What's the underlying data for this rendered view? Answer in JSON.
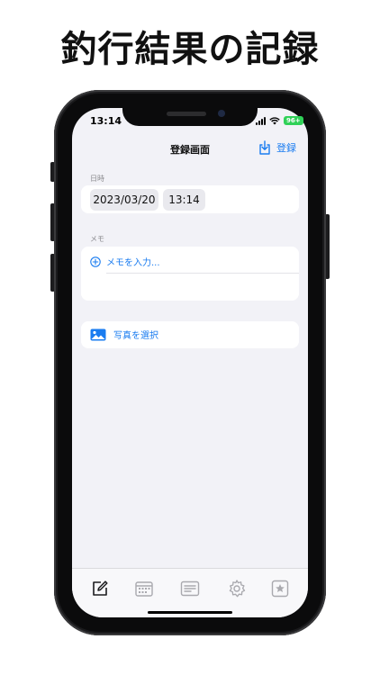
{
  "headline": "釣行結果の記録",
  "status_bar": {
    "time": "13:14",
    "battery": "96+"
  },
  "nav": {
    "title": "登録画面",
    "action_label": "登録"
  },
  "datetime": {
    "label": "日時",
    "date": "2023/03/20",
    "time": "13:14"
  },
  "memo": {
    "label": "メモ",
    "placeholder": "メモを入力..."
  },
  "photo": {
    "label": "写真を選択"
  },
  "tabs": [
    {
      "icon": "edit-icon",
      "active": true
    },
    {
      "icon": "calendar-icon",
      "active": false
    },
    {
      "icon": "list-icon",
      "active": false
    },
    {
      "icon": "gear-icon",
      "active": false
    },
    {
      "icon": "star-icon",
      "active": false
    }
  ],
  "colors": {
    "accent": "#1a7cf0",
    "background": "#f2f2f7",
    "battery": "#30d158"
  }
}
